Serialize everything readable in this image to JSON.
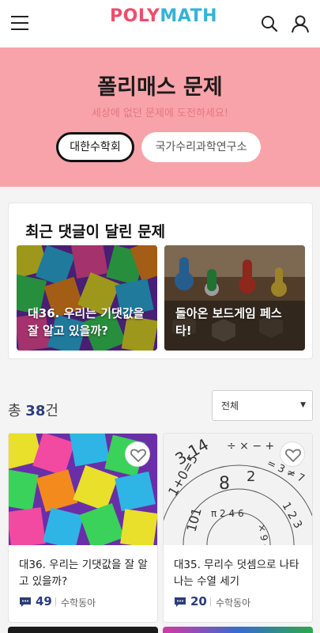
{
  "header": {
    "logo_small": "수학동아",
    "logo_part1": "POLY",
    "logo_part2": "MATH"
  },
  "hero": {
    "title": "폴리매스 문제",
    "subtitle": "세상에 없던 문제에 도전하세요!",
    "tabs": [
      {
        "label": "대한수학회",
        "active": true
      },
      {
        "label": "국가수리과학연구소",
        "active": false
      }
    ]
  },
  "recent": {
    "title": "최근 댓글이 달린 문제",
    "items": [
      {
        "title": "대36. 우리는 기댓값을 잘 알고 있을까?"
      },
      {
        "title": "돌아온 보드게임 페스타!"
      }
    ]
  },
  "list": {
    "count_prefix": "총",
    "count": "38",
    "count_suffix": "건",
    "filter": "전체",
    "cards": [
      {
        "title": "대36. 우리는 기댓값을 잘 알고 있을까?",
        "comments": "49",
        "author": "수학동아"
      },
      {
        "title": "대35. 무리수 덧셈으로 나타나는 수열 세기",
        "comments": "20",
        "author": "수학동아"
      }
    ]
  },
  "colors": {
    "hero_bg": "#f7a3a9",
    "accent_navy": "#2a3d7a",
    "logo_red": "#ef4d6c",
    "logo_blue": "#34b3d6"
  }
}
